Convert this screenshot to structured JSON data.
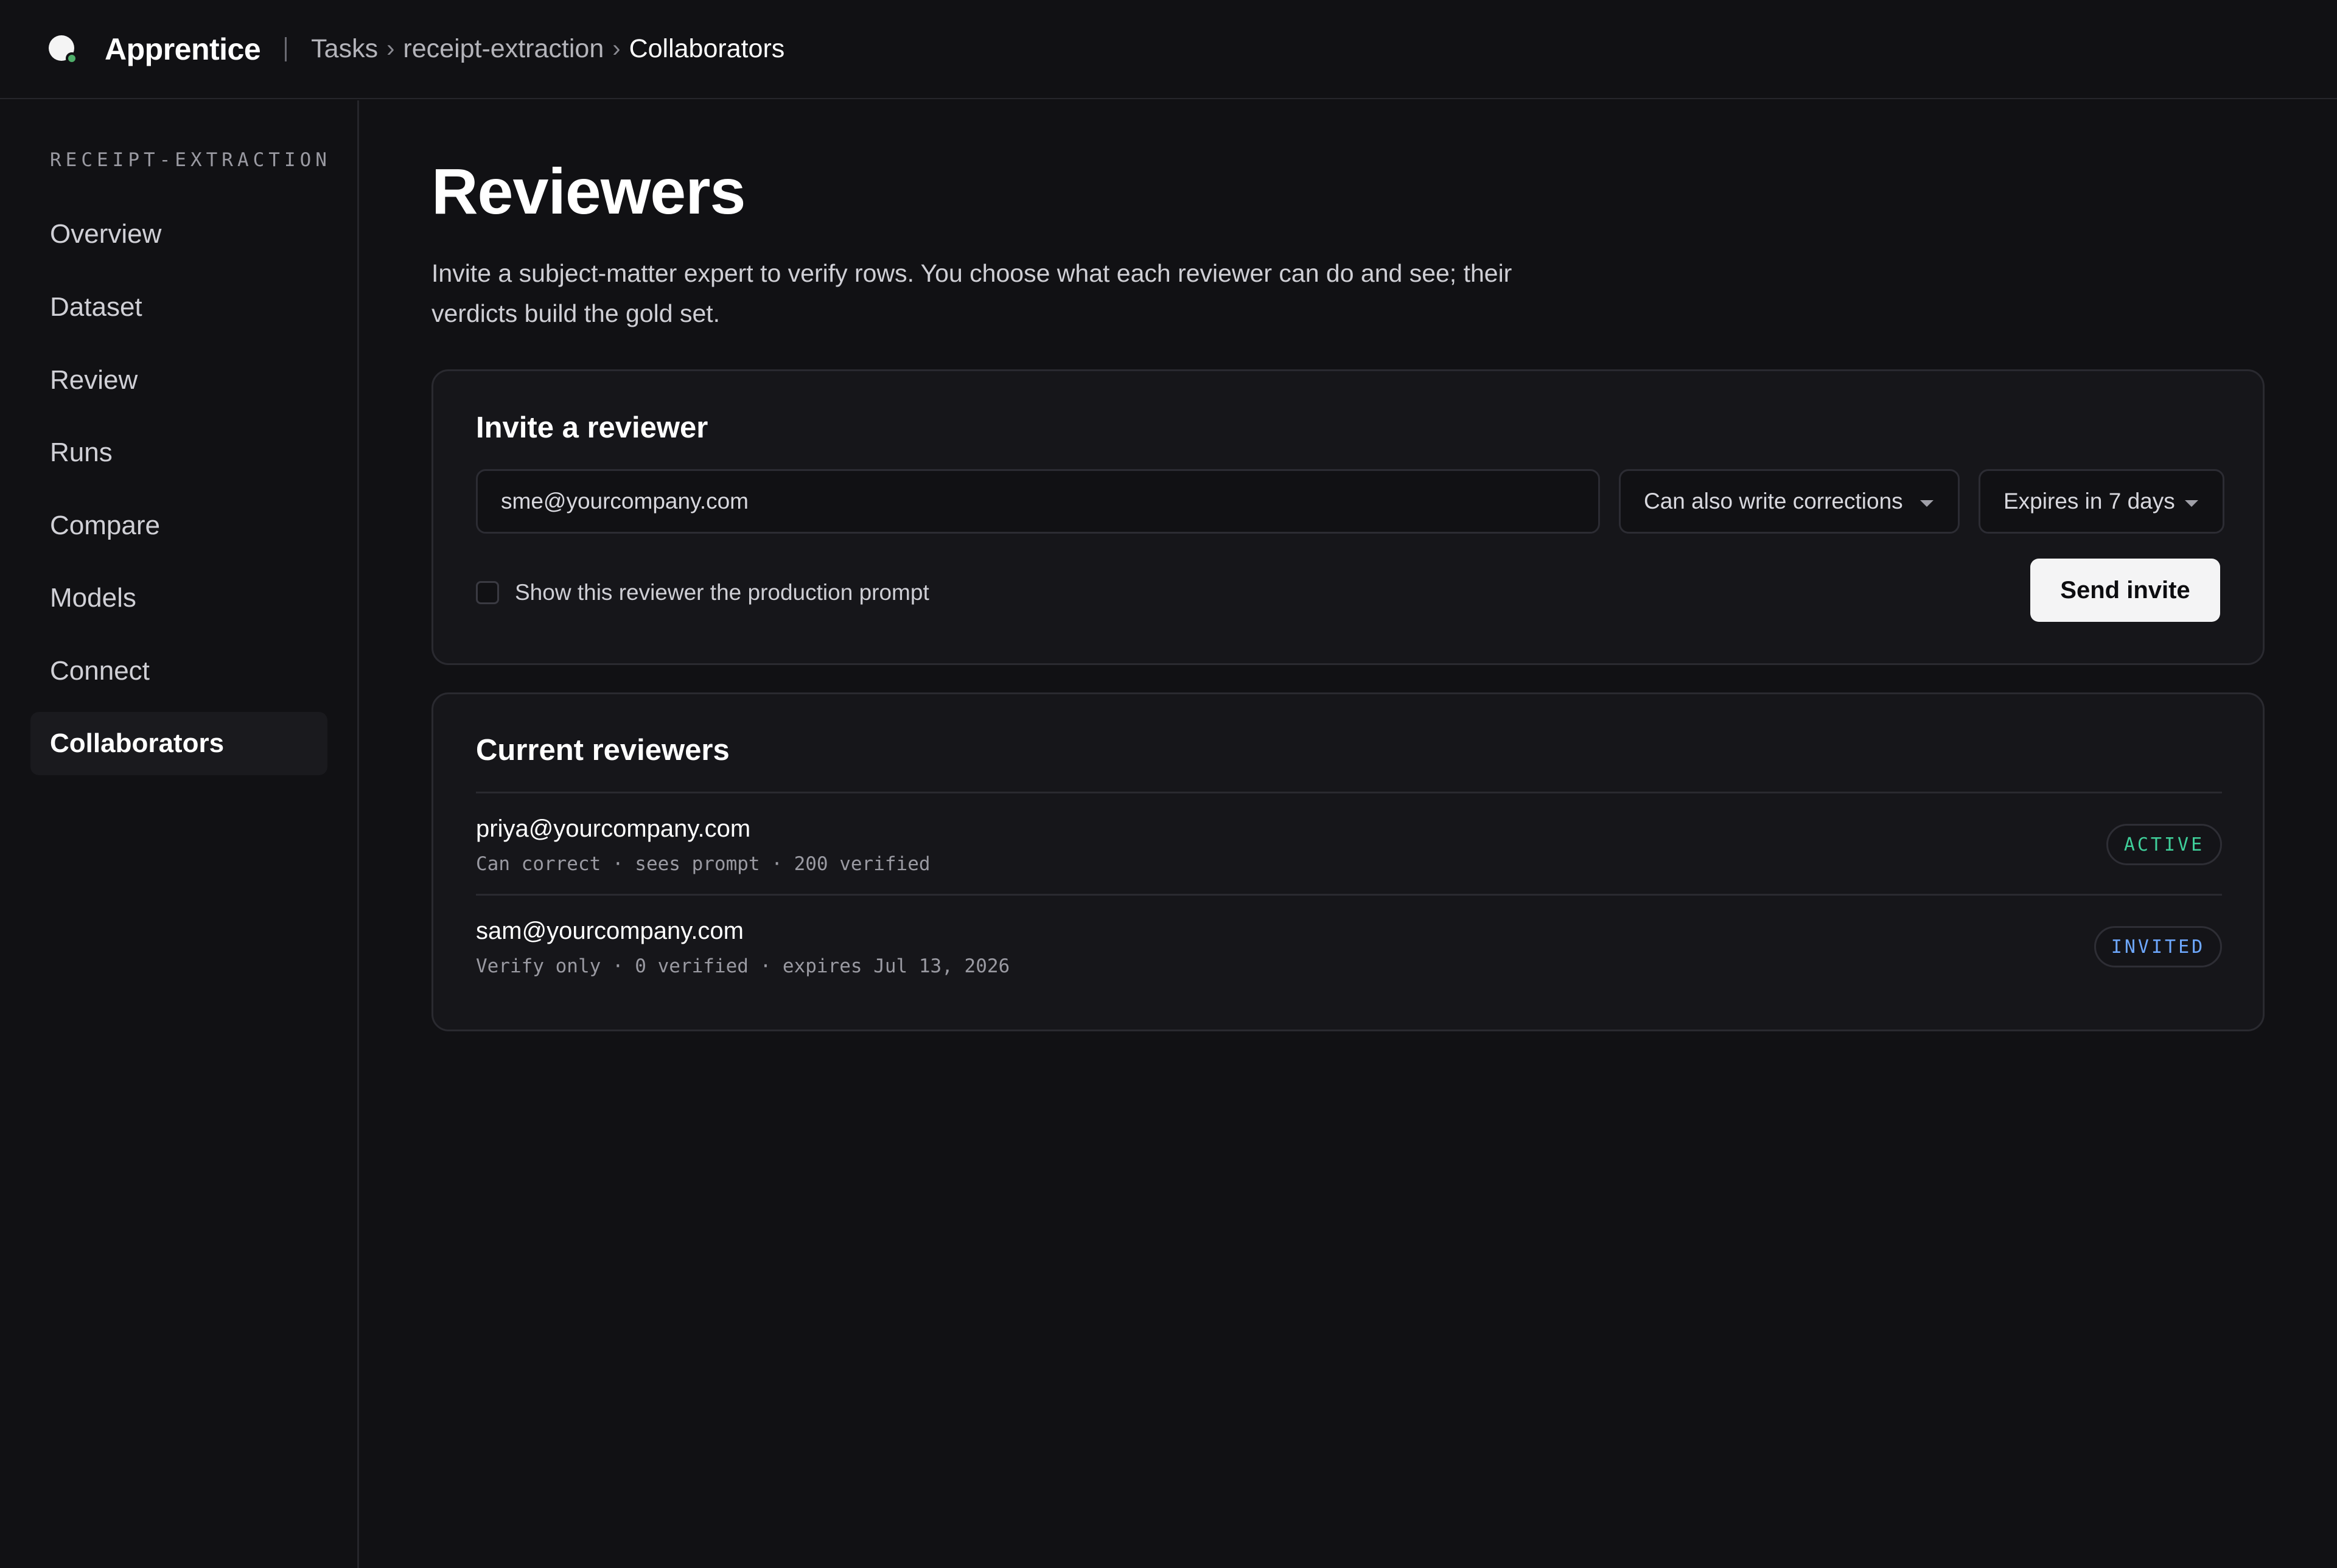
{
  "app": {
    "name": "Apprentice"
  },
  "breadcrumb": {
    "items": [
      "Tasks",
      "receipt-extraction",
      "Collaborators"
    ]
  },
  "sidebar": {
    "heading": "RECEIPT-EXTRACTION",
    "items": [
      {
        "label": "Overview"
      },
      {
        "label": "Dataset"
      },
      {
        "label": "Review"
      },
      {
        "label": "Runs"
      },
      {
        "label": "Compare"
      },
      {
        "label": "Models"
      },
      {
        "label": "Connect"
      },
      {
        "label": "Collaborators",
        "active": true
      }
    ]
  },
  "page": {
    "title": "Reviewers",
    "subtitle": "Invite a subject-matter expert to verify rows. You choose what each reviewer can do and see; their verdicts build the gold set."
  },
  "invite": {
    "title": "Invite a reviewer",
    "email_value": "sme@yourcompany.com",
    "permission_selected": "Can also write corrections",
    "expiry_selected": "Expires in 7 days",
    "show_prompt_label": "Show this reviewer the production prompt",
    "show_prompt_checked": false,
    "send_label": "Send invite"
  },
  "reviewers": {
    "title": "Current reviewers",
    "rows": [
      {
        "email": "priya@yourcompany.com",
        "meta": "Can correct · sees prompt · 200 verified",
        "status": "ACTIVE",
        "status_color": "#3fcf9a"
      },
      {
        "email": "sam@yourcompany.com",
        "meta": "Verify only · 0 verified · expires Jul 13, 2026",
        "status": "INVITED",
        "status_color": "#6ea8ff"
      }
    ]
  },
  "colors": {
    "background": "#111114",
    "card": "#16161a",
    "border": "#2a2a30",
    "accent_green": "#4fae6a"
  }
}
